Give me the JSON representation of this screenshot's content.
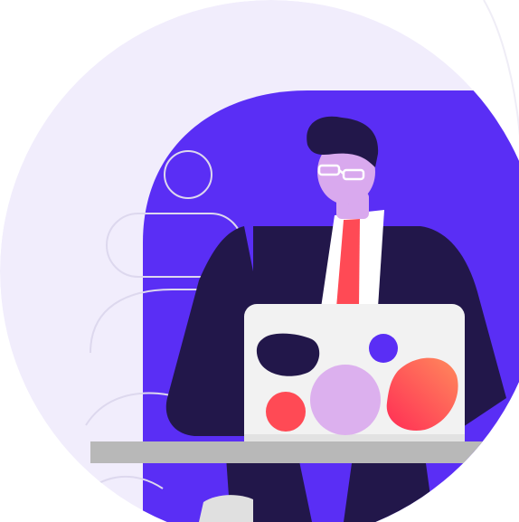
{
  "illustration": {
    "subject": "person-with-laptop",
    "icons": [
      "person-icon",
      "laptop-icon",
      "glasses-icon",
      "necktie-icon"
    ],
    "colors": {
      "page_background": "#ffffff",
      "outer_circle": "#f1edfc",
      "arch": "#5a2ef5",
      "suit": "#22174a",
      "hair": "#22174a",
      "skin": "#d9a9ee",
      "shirt": "#ffffff",
      "tie": "#ff4a55",
      "laptop": "#f2f2f2",
      "laptop_shadow": "#e2e2e2",
      "desk": "#b8b8b8",
      "blob_dark": "#22174a",
      "blob_violet": "#5a2ef5",
      "blob_red": "#ff4a55",
      "blob_pink": "#dcb0ee",
      "blob_gradient_start": "#ff2d55",
      "blob_gradient_end": "#ff8a5c",
      "outline_strokes": "#ddd8ee"
    }
  }
}
